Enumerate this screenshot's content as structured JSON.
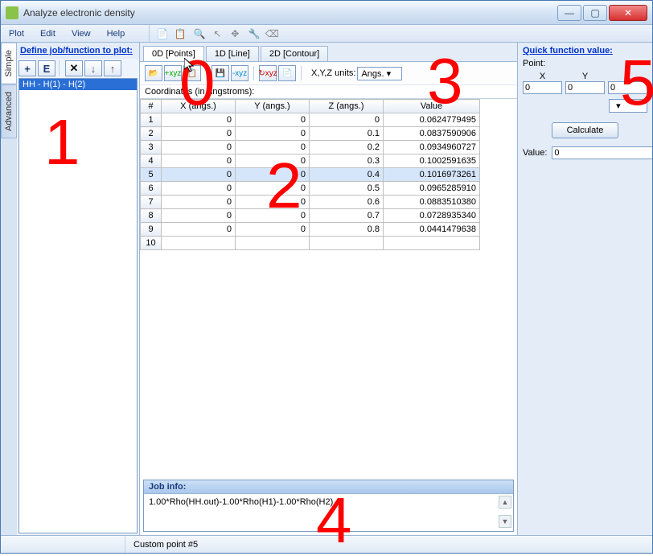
{
  "window_title": "Analyze electronic density",
  "menus": {
    "plot": "Plot",
    "edit": "Edit",
    "view": "View",
    "help": "Help"
  },
  "left": {
    "define_label": "Define job/function to plot:",
    "side_simple": "Simple",
    "side_advanced": "Advanced",
    "job_selected": "HH - H(1) - H(2)"
  },
  "tabs": {
    "points": "0D [Points]",
    "line": "1D [Line]",
    "contour": "2D [Contour]"
  },
  "units_label": "X,Y,Z units:",
  "units_value": "Angs.",
  "coord_label": "Coordinates (in Angstroms):",
  "columns": {
    "num": "#",
    "x": "X (angs.)",
    "y": "Y (angs.)",
    "z": "Z (angs.)",
    "v": "Value"
  },
  "rows": [
    {
      "n": "1",
      "x": "0",
      "y": "0",
      "z": "0",
      "v": "0.0624779495",
      "sel": false
    },
    {
      "n": "2",
      "x": "0",
      "y": "0",
      "z": "0.1",
      "v": "0.0837590906",
      "sel": false
    },
    {
      "n": "3",
      "x": "0",
      "y": "0",
      "z": "0.2",
      "v": "0.0934960727",
      "sel": false
    },
    {
      "n": "4",
      "x": "0",
      "y": "0",
      "z": "0.3",
      "v": "0.1002591635",
      "sel": false
    },
    {
      "n": "5",
      "x": "0",
      "y": "0",
      "z": "0.4",
      "v": "0.1016973261",
      "sel": true
    },
    {
      "n": "6",
      "x": "0",
      "y": "0",
      "z": "0.5",
      "v": "0.0965285910",
      "sel": false
    },
    {
      "n": "7",
      "x": "0",
      "y": "0",
      "z": "0.6",
      "v": "0.0883510380",
      "sel": false
    },
    {
      "n": "8",
      "x": "0",
      "y": "0",
      "z": "0.7",
      "v": "0.0728935340",
      "sel": false
    },
    {
      "n": "9",
      "x": "0",
      "y": "0",
      "z": "0.8",
      "v": "0.0441479638",
      "sel": false
    },
    {
      "n": "10",
      "x": "",
      "y": "",
      "z": "",
      "v": "",
      "sel": false
    }
  ],
  "jobinfo": {
    "header": "Job info:",
    "text": "1.00*Rho(HH.out)-1.00*Rho(H1)-1.00*Rho(H2)"
  },
  "right": {
    "section": "Quick function value:",
    "point_label": "Point:",
    "x_label": "X",
    "y_label": "Y",
    "z_label": "Z",
    "x_val": "0",
    "y_val": "0",
    "z_val": "0",
    "calculate": "Calculate",
    "value_label": "Value:",
    "value_val": "0"
  },
  "status": "Custom point #5",
  "overlay": {
    "n1": "1",
    "n2": "2",
    "n3": "3",
    "n4": "4",
    "n5": "5",
    "n0": "0"
  }
}
